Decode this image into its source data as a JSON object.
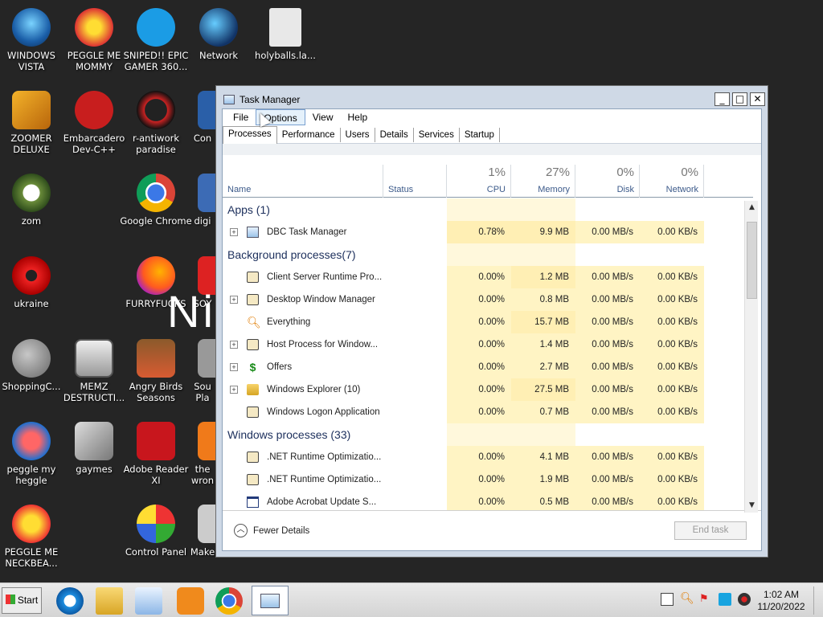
{
  "desktop": {
    "icons": [
      {
        "label": "WINDOWS VISTA",
        "icon": "vista-orb-icon"
      },
      {
        "label": "PEGGLE ME MOMMY",
        "icon": "peggle-icon"
      },
      {
        "label": "SNIPED!! EPIC GAMER 360...",
        "icon": "skype-icon"
      },
      {
        "label": "Network",
        "icon": "network-globe-icon"
      },
      {
        "label": "holyballs.la...",
        "icon": "file-icon"
      },
      {
        "label": "ZOOMER DELUXE",
        "icon": "zoomer-icon"
      },
      {
        "label": "Embarcadero Dev-C++",
        "icon": "devcpp-icon"
      },
      {
        "label": "r-antiwork paradise",
        "icon": "antiwork-icon"
      },
      {
        "label": "Con",
        "icon": "app-icon"
      },
      {
        "label": "zom",
        "icon": "flower-icon"
      },
      {
        "label": "Google Chrome",
        "icon": "chrome-icon"
      },
      {
        "label": "digi",
        "icon": "app-icon"
      },
      {
        "label": "ukraine",
        "icon": "radiation-icon"
      },
      {
        "label": "FURRYFUCKS",
        "icon": "firefox-icon"
      },
      {
        "label": "SOY",
        "icon": "app-icon"
      },
      {
        "label": "ShoppingC...",
        "icon": "flash-icon"
      },
      {
        "label": "MEMZ DESTRUCTI...",
        "icon": "memz-icon"
      },
      {
        "label": "Angry Birds Seasons",
        "icon": "angry-birds-icon"
      },
      {
        "label": "Sou Pla",
        "icon": "app-icon"
      },
      {
        "label": "peggle my heggle",
        "icon": "peggle-icon"
      },
      {
        "label": "gaymes",
        "icon": "folder-icon"
      },
      {
        "label": "Adobe Reader XI",
        "icon": "adobe-reader-icon"
      },
      {
        "label": "the wron",
        "icon": "app-icon"
      },
      {
        "label": "PEGGLE ME NECKBEA...",
        "icon": "peggle-icon"
      },
      {
        "label": "Control Panel",
        "icon": "control-panel-icon"
      },
      {
        "label": "Make",
        "icon": "app-icon"
      }
    ],
    "bignum": "Ni"
  },
  "window": {
    "title": "Task Manager",
    "menu": [
      "File",
      "Options",
      "View",
      "Help"
    ],
    "tabs": [
      "Processes",
      "Performance",
      "Users",
      "Details",
      "Services",
      "Startup"
    ],
    "columns": {
      "name": "Name",
      "status": "Status",
      "cpu": {
        "pct": "1%",
        "label": "CPU"
      },
      "memory": {
        "pct": "27%",
        "label": "Memory"
      },
      "disk": {
        "pct": "0%",
        "label": "Disk"
      },
      "network": {
        "pct": "0%",
        "label": "Network"
      }
    },
    "groups": {
      "apps": "Apps (1)",
      "background": "Background processes(7)",
      "windows": "Windows processes (33)"
    },
    "rows": [
      {
        "name": "DBC Task Manager",
        "cpu": "0.78%",
        "mem": "9.9 MB",
        "disk": "0.00 MB/s",
        "net": "0.00 KB/s"
      },
      {
        "name": "Client Server Runtime Pro...",
        "cpu": "0.00%",
        "mem": "1.2 MB",
        "disk": "0.00 MB/s",
        "net": "0.00 KB/s"
      },
      {
        "name": "Desktop Window Manager",
        "cpu": "0.00%",
        "mem": "0.8 MB",
        "disk": "0.00 MB/s",
        "net": "0.00 KB/s"
      },
      {
        "name": "Everything",
        "cpu": "0.00%",
        "mem": "15.7 MB",
        "disk": "0.00 MB/s",
        "net": "0.00 KB/s"
      },
      {
        "name": "Host Process for Window...",
        "cpu": "0.00%",
        "mem": "1.4 MB",
        "disk": "0.00 MB/s",
        "net": "0.00 KB/s"
      },
      {
        "name": "Offers",
        "cpu": "0.00%",
        "mem": "2.7 MB",
        "disk": "0.00 MB/s",
        "net": "0.00 KB/s"
      },
      {
        "name": "Windows Explorer (10)",
        "cpu": "0.00%",
        "mem": "27.5 MB",
        "disk": "0.00 MB/s",
        "net": "0.00 KB/s"
      },
      {
        "name": "Windows Logon Application",
        "cpu": "0.00%",
        "mem": "0.7 MB",
        "disk": "0.00 MB/s",
        "net": "0.00 KB/s"
      },
      {
        "name": ".NET Runtime Optimizatio...",
        "cpu": "0.00%",
        "mem": "4.1 MB",
        "disk": "0.00 MB/s",
        "net": "0.00 KB/s"
      },
      {
        "name": ".NET Runtime Optimizatio...",
        "cpu": "0.00%",
        "mem": "1.9 MB",
        "disk": "0.00 MB/s",
        "net": "0.00 KB/s"
      },
      {
        "name": "Adobe Acrobat Update S...",
        "cpu": "0.00%",
        "mem": "0.5 MB",
        "disk": "0.00 MB/s",
        "net": "0.00 KB/s"
      }
    ],
    "footer": {
      "fewer": "Fewer Details",
      "end_task": "End task"
    }
  },
  "taskbar": {
    "start": "Start",
    "time": "1:02 AM",
    "date": "11/20/2022"
  }
}
